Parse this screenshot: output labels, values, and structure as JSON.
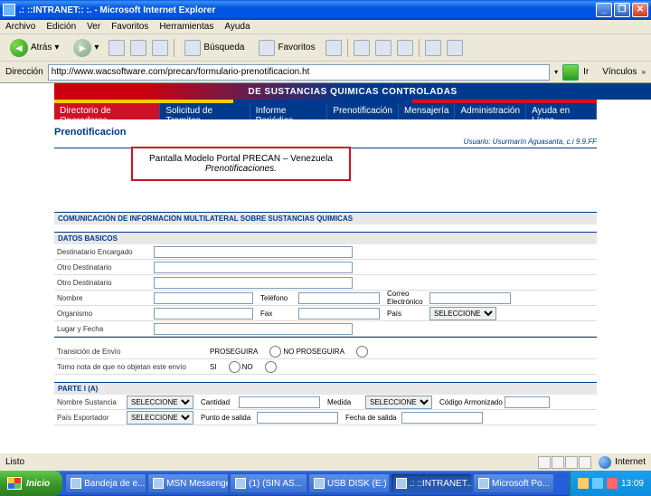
{
  "window": {
    "title": ".: ::INTRANET:: :. - Microsoft Internet Explorer"
  },
  "menu": [
    "Archivo",
    "Edición",
    "Ver",
    "Favoritos",
    "Herramientas",
    "Ayuda"
  ],
  "toolbar": {
    "back": "Atrás",
    "search": "Búsqueda",
    "favorites": "Favoritos"
  },
  "address": {
    "label": "Dirección",
    "url": "http://www.wacsoftware.com/precan/formulario-prenotificacion.ht",
    "go": "Ir",
    "links": "Vínculos"
  },
  "banner": "DE SUSTANCIAS QUIMICAS CONTROLADAS",
  "tabs": [
    "Directorio de Operadores",
    "Solicitud de Tramites",
    "Informe Periódico",
    "Prenotificación",
    "Mensajería",
    "Administración",
    "Ayuda en Línea"
  ],
  "page": {
    "title": "Prenotificacion",
    "user": "Usuario: Usurmarín Aguasanta, c.i 9.9.FF"
  },
  "overlay": {
    "line1": "Pantalla Modelo Portal PRECAN – Venezuela",
    "line2": "Prenotificaciones."
  },
  "form": {
    "maintitle": "COMUNICACIÓN DE INFORMACION MULTILATERAL SOBRE SUSTANCIAS QUIMICAS",
    "sec1": "DATOS BASICOS",
    "f1": "Destinatario Encargado",
    "f2": "Otro Destinatario",
    "f3": "Otro Destinatario",
    "f4": "Nombre",
    "f4b": "Teléfono",
    "f4c": "Correo Electrónico",
    "f5": "Organismo",
    "f5b": "Fax",
    "f5c": "País",
    "f6": "Lugar y Fecha",
    "f7": "Transición de Envío",
    "f7a": "PROSEGUIRA",
    "f7b": "NO PROSEGUIRA",
    "f8": "Tomo nota de que no objetan este envío",
    "f8a": "SI",
    "f8b": "NO",
    "sec2": "PARTE I (A)",
    "f9": "Nombre Sustancia",
    "f9b": "Cantidad",
    "f9c": "Medida",
    "f9d": "Código Armonizado",
    "f10": "País Exportador",
    "f10b": "Punto de salida",
    "f10c": "Fecha de salida",
    "sel": "SELECCIONE"
  },
  "status": {
    "left": "Listo",
    "zone": "Internet"
  },
  "taskbar": {
    "start": "Inicio",
    "items": [
      "Bandeja de e...",
      "MSN Messenger",
      "(1) (SIN AS...",
      "USB DISK (E:)",
      ".: ::INTRANET...",
      "Microsoft Po..."
    ],
    "time": "13:09"
  }
}
